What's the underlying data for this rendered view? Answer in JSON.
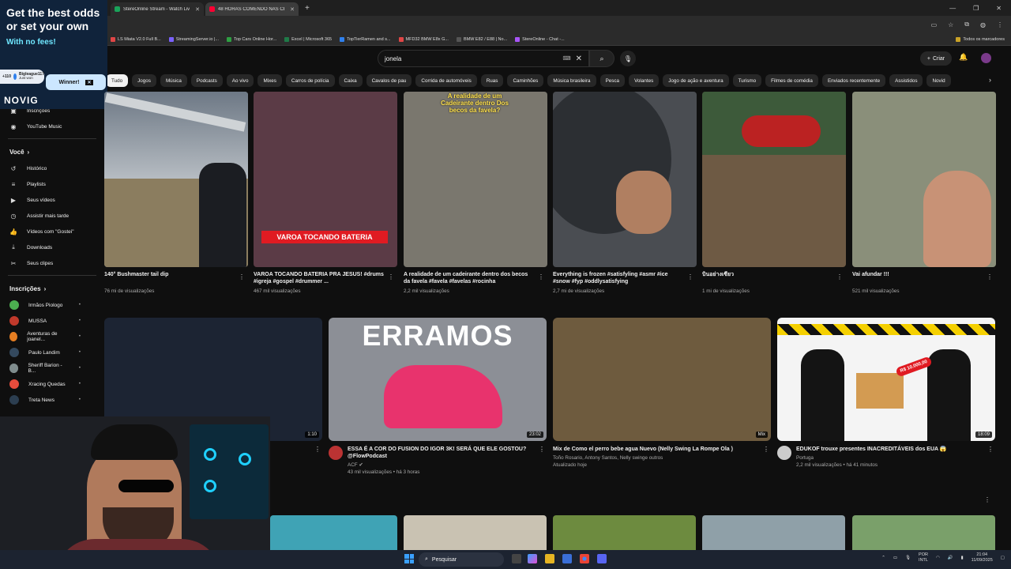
{
  "browser": {
    "tabs": [
      {
        "title": "StereOnline Stream - Watch Live",
        "color": "#1aa35a"
      },
      {
        "title": "48 HORAS COMENDO NAS CE",
        "color": "#ff0033"
      }
    ],
    "bookmarks": [
      {
        "label": "LS Miata V2.0 Full B...",
        "color": "#e04646"
      },
      {
        "label": "StreamingServer.io |...",
        "color": "#7b61ff"
      },
      {
        "label": "Top Cars Online Hor...",
        "color": "#2ea043"
      },
      {
        "label": "Excel | Microsoft 365",
        "color": "#1f7a48"
      },
      {
        "label": "TopTierRamen and s...",
        "color": "#2f80ed"
      },
      {
        "label": "MFD32 BMW E8x G...",
        "color": "#e04646"
      },
      {
        "label": "BMW E82 / E88 | No...",
        "color": "#555"
      },
      {
        "label": "StereOnline - Chat -...",
        "color": "#a855f7"
      }
    ],
    "bookmarks_folder": "Todos os marcadores"
  },
  "ad": {
    "headline": "Get the best odds or set your own",
    "sub": "With no fees!",
    "badge_count": "+110",
    "badge_user": "Bigleague117",
    "badge_sub": "Just won",
    "winner": "Winner!",
    "logo": "NOVIG"
  },
  "youtube": {
    "search_value": "jonela",
    "create_label": "Criar",
    "chips": [
      "Tudo",
      "Jogos",
      "Música",
      "Podcasts",
      "Ao vivo",
      "Mixes",
      "Carros de polícia",
      "Caixa",
      "Cavalos de pau",
      "Corrida de automóveis",
      "Ruas",
      "Caminhões",
      "Música brasileira",
      "Pesca",
      "Volantes",
      "Jogo de ação e aventura",
      "Turismo",
      "Filmes de comédia",
      "Enviados recentemente",
      "Assistidos",
      "Novid"
    ],
    "sidebar": {
      "top": [
        {
          "icon": "▣",
          "label": "Inscrições"
        },
        {
          "icon": "◉",
          "label": "YouTube Music"
        }
      ],
      "you_title": "Você",
      "you": [
        {
          "icon": "↺",
          "label": "Histórico"
        },
        {
          "icon": "≡",
          "label": "Playlists"
        },
        {
          "icon": "▶",
          "label": "Seus vídeos"
        },
        {
          "icon": "◷",
          "label": "Assistir mais tarde"
        },
        {
          "icon": "👍",
          "label": "Vídeos com \"Gostei\""
        },
        {
          "icon": "⤓",
          "label": "Downloads"
        },
        {
          "icon": "✂",
          "label": "Seus clipes"
        }
      ],
      "subs_title": "Inscrições",
      "subs": [
        {
          "label": "Irmãos Piologo",
          "color": "#4caf50"
        },
        {
          "label": "MUSSA",
          "color": "#c0392b"
        },
        {
          "label": "Aventuras de joanel...",
          "color": "#e67e22"
        },
        {
          "label": "Paulo Landim",
          "color": "#34495e"
        },
        {
          "label": "Sheriff Barion - B...",
          "color": "#7f8c8d"
        },
        {
          "label": "Xracing Quedas",
          "color": "#e74c3c"
        },
        {
          "label": "Treta News",
          "color": "#2c3e50"
        }
      ]
    },
    "shorts": [
      {
        "title": "140° Bushmaster tail dip",
        "views": "76 mi de visualizações",
        "bg": "#9aa3ad"
      },
      {
        "title": "VAROA TOCANDO BATERIA PRA JESUS! #drums #igreja #gospel #drummer ...",
        "views": "467 mil visualizações",
        "bg": "#5b3b46",
        "overlay": "VAROA TOCANDO BATERIA"
      },
      {
        "title": "A realidade de um cadeirante dentro dos becos da favela #favela #favelas #rocinha",
        "views": "2,2 mil visualizações",
        "bg": "#7a776e",
        "overlay": "A realidade de um Cadeirante dentro Dos becos da favela?"
      },
      {
        "title": "Everything is frozen #satisfyling #asmr #ice #snow #fyp #oddlysatisfying",
        "views": "2,7 mi de visualizações",
        "bg": "#4a4d52"
      },
      {
        "title": "บินอย่างเซียว",
        "views": "1 mi de visualizações",
        "bg": "#6e5a44"
      },
      {
        "title": "Vai afundar !!!",
        "views": "521 mil visualizações",
        "bg": "#8a8f7a"
      }
    ],
    "videos": [
      {
        "title": "",
        "meta1": "",
        "meta2": "",
        "duration": "1:10",
        "bg": "#1c2433"
      },
      {
        "title": "ESSA É A COR DO FUSION DO IGOR 3K! SERÁ QUE ELE GOSTOU? @FlowPodcast",
        "meta1": "ACF ✔",
        "meta2": "43 mil visualizações • há 3 horas",
        "duration": "23:02",
        "bg": "#8c8f96",
        "bigtext": "ERRAMOS",
        "avatar": "#b33"
      },
      {
        "title": "Mix de Como el perro bebe agua Nuevo  (Nelly Swing La Rompe Ola )",
        "meta1": "Toño Rosario, Antony Santos, Nelly swinge outros",
        "meta2": "Atualizado hoje",
        "duration": "Mix",
        "bg": "#6e5b3e"
      },
      {
        "title": "EDUKOF trouxe presentes INACREDITÁVEIS dos EUA 😱",
        "meta1": "Portuga",
        "meta2": "2,2 mil visualizações • há 41 minutos",
        "duration": "18:09",
        "bg": "#f4f4f4",
        "avatar": "#ccc",
        "price": "R$ 10.000,00"
      }
    ],
    "row3_colors": [
      "#3fa3b5",
      "#c9c2b2",
      "#6d8b3f",
      "#8fa0a8",
      "#7aa06a"
    ]
  },
  "taskbar": {
    "search": "Pesquisar",
    "lang": "POR\nINTL",
    "time": "21:04",
    "date": "11/09/2025"
  }
}
